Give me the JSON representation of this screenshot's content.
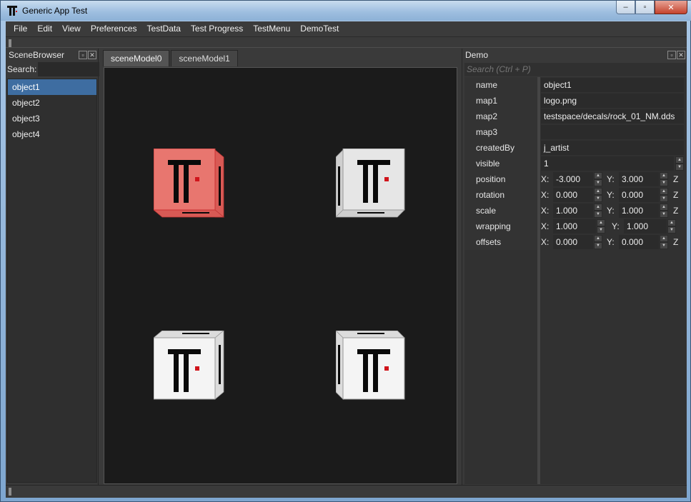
{
  "window": {
    "title": "Generic App Test",
    "minimize": "–",
    "maximize": "▫",
    "close": "✕"
  },
  "menu": [
    "File",
    "Edit",
    "View",
    "Preferences",
    "TestData",
    "Test Progress",
    "TestMenu",
    "DemoTest"
  ],
  "scene_browser": {
    "title": "SceneBrowser",
    "search_label": "Search:",
    "search_value": "",
    "objects": [
      "object1",
      "object2",
      "object3",
      "object4"
    ],
    "selected": "object1"
  },
  "tabs": [
    "sceneModel0",
    "sceneModel1"
  ],
  "active_tab": "sceneModel0",
  "viewport": {
    "cubes": [
      {
        "name": "object1",
        "selected": true,
        "color": "#e8766f"
      },
      {
        "name": "object2",
        "selected": false,
        "color": "#e6e6e6"
      },
      {
        "name": "object3",
        "selected": false,
        "color": "#f4f4f4"
      },
      {
        "name": "object4",
        "selected": false,
        "color": "#f4f4f4"
      }
    ]
  },
  "demo": {
    "title": "Demo",
    "search_placeholder": "Search (Ctrl + P)",
    "props": {
      "name": {
        "label": "name",
        "value": "object1"
      },
      "map1": {
        "label": "map1",
        "value": "logo.png"
      },
      "map2": {
        "label": "map2",
        "value": "testspace/decals/rock_01_NM.dds"
      },
      "map3": {
        "label": "map3",
        "value": ""
      },
      "createdBy": {
        "label": "createdBy",
        "value": "j_artist"
      },
      "visible": {
        "label": "visible",
        "value": "1"
      },
      "position": {
        "label": "position",
        "x": "-3.000",
        "y": "3.000"
      },
      "rotation": {
        "label": "rotation",
        "x": "0.000",
        "y": "0.000"
      },
      "scale": {
        "label": "scale",
        "x": "1.000",
        "y": "1.000"
      },
      "wrapping": {
        "label": "wrapping",
        "x": "1.000",
        "y": "1.000"
      },
      "offsets": {
        "label": "offsets",
        "x": "0.000",
        "y": "0.000"
      }
    },
    "axis": {
      "x": "X:",
      "y": "Y:",
      "z": "Z"
    }
  },
  "colors": {
    "selection": "#3e6da1",
    "accent_red": "#d0141b"
  }
}
